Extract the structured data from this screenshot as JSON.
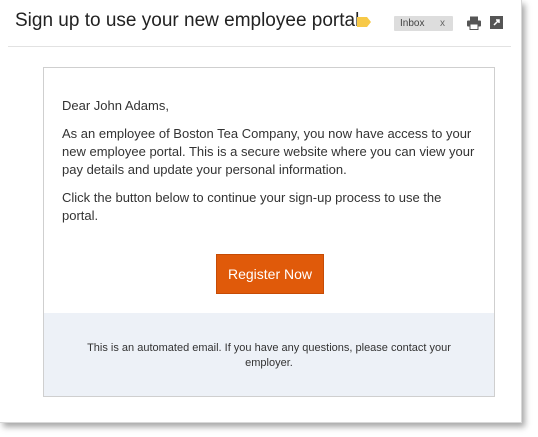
{
  "header": {
    "subject": "Sign up to use your new employee portal",
    "label_color": "#f7c948",
    "inbox_chip": {
      "label": "Inbox",
      "remove": "x"
    },
    "icons": [
      "label-tag-icon",
      "print-icon",
      "open-in-new-window-icon"
    ]
  },
  "email": {
    "greeting": "Dear John Adams,",
    "paragraph1": "As an employee of Boston Tea Company, you now have access to your new employee portal. This is a secure website where you can view your pay details and update your personal information.",
    "paragraph2": "Click the button below to continue your sign-up process to use the portal.",
    "button_label": "Register Now",
    "button_color": "#e05a0a",
    "footer_text": "This is an automated email. If you have any questions, please contact your employer.",
    "footer_background": "#edf1f7"
  }
}
